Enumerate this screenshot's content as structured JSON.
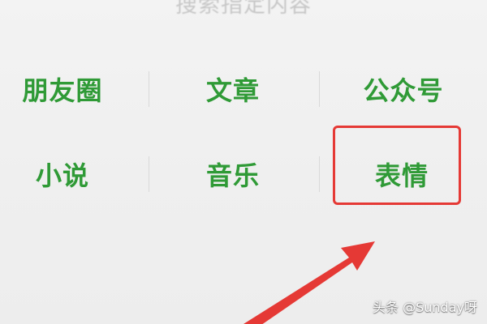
{
  "search": {
    "hint": "搜索指定内容"
  },
  "categories": [
    {
      "label": "朋友圈"
    },
    {
      "label": "文章"
    },
    {
      "label": "公众号"
    },
    {
      "label": "小说"
    },
    {
      "label": "音乐"
    },
    {
      "label": "表情"
    }
  ],
  "annotation": {
    "box_color": "#e53935",
    "arrow_color": "#e53935"
  },
  "watermark": {
    "text": "头条 @Sunday呀"
  },
  "colors": {
    "label_green": "#2f9a36",
    "background": "#efefef",
    "hint_gray": "#c7c7c7"
  }
}
